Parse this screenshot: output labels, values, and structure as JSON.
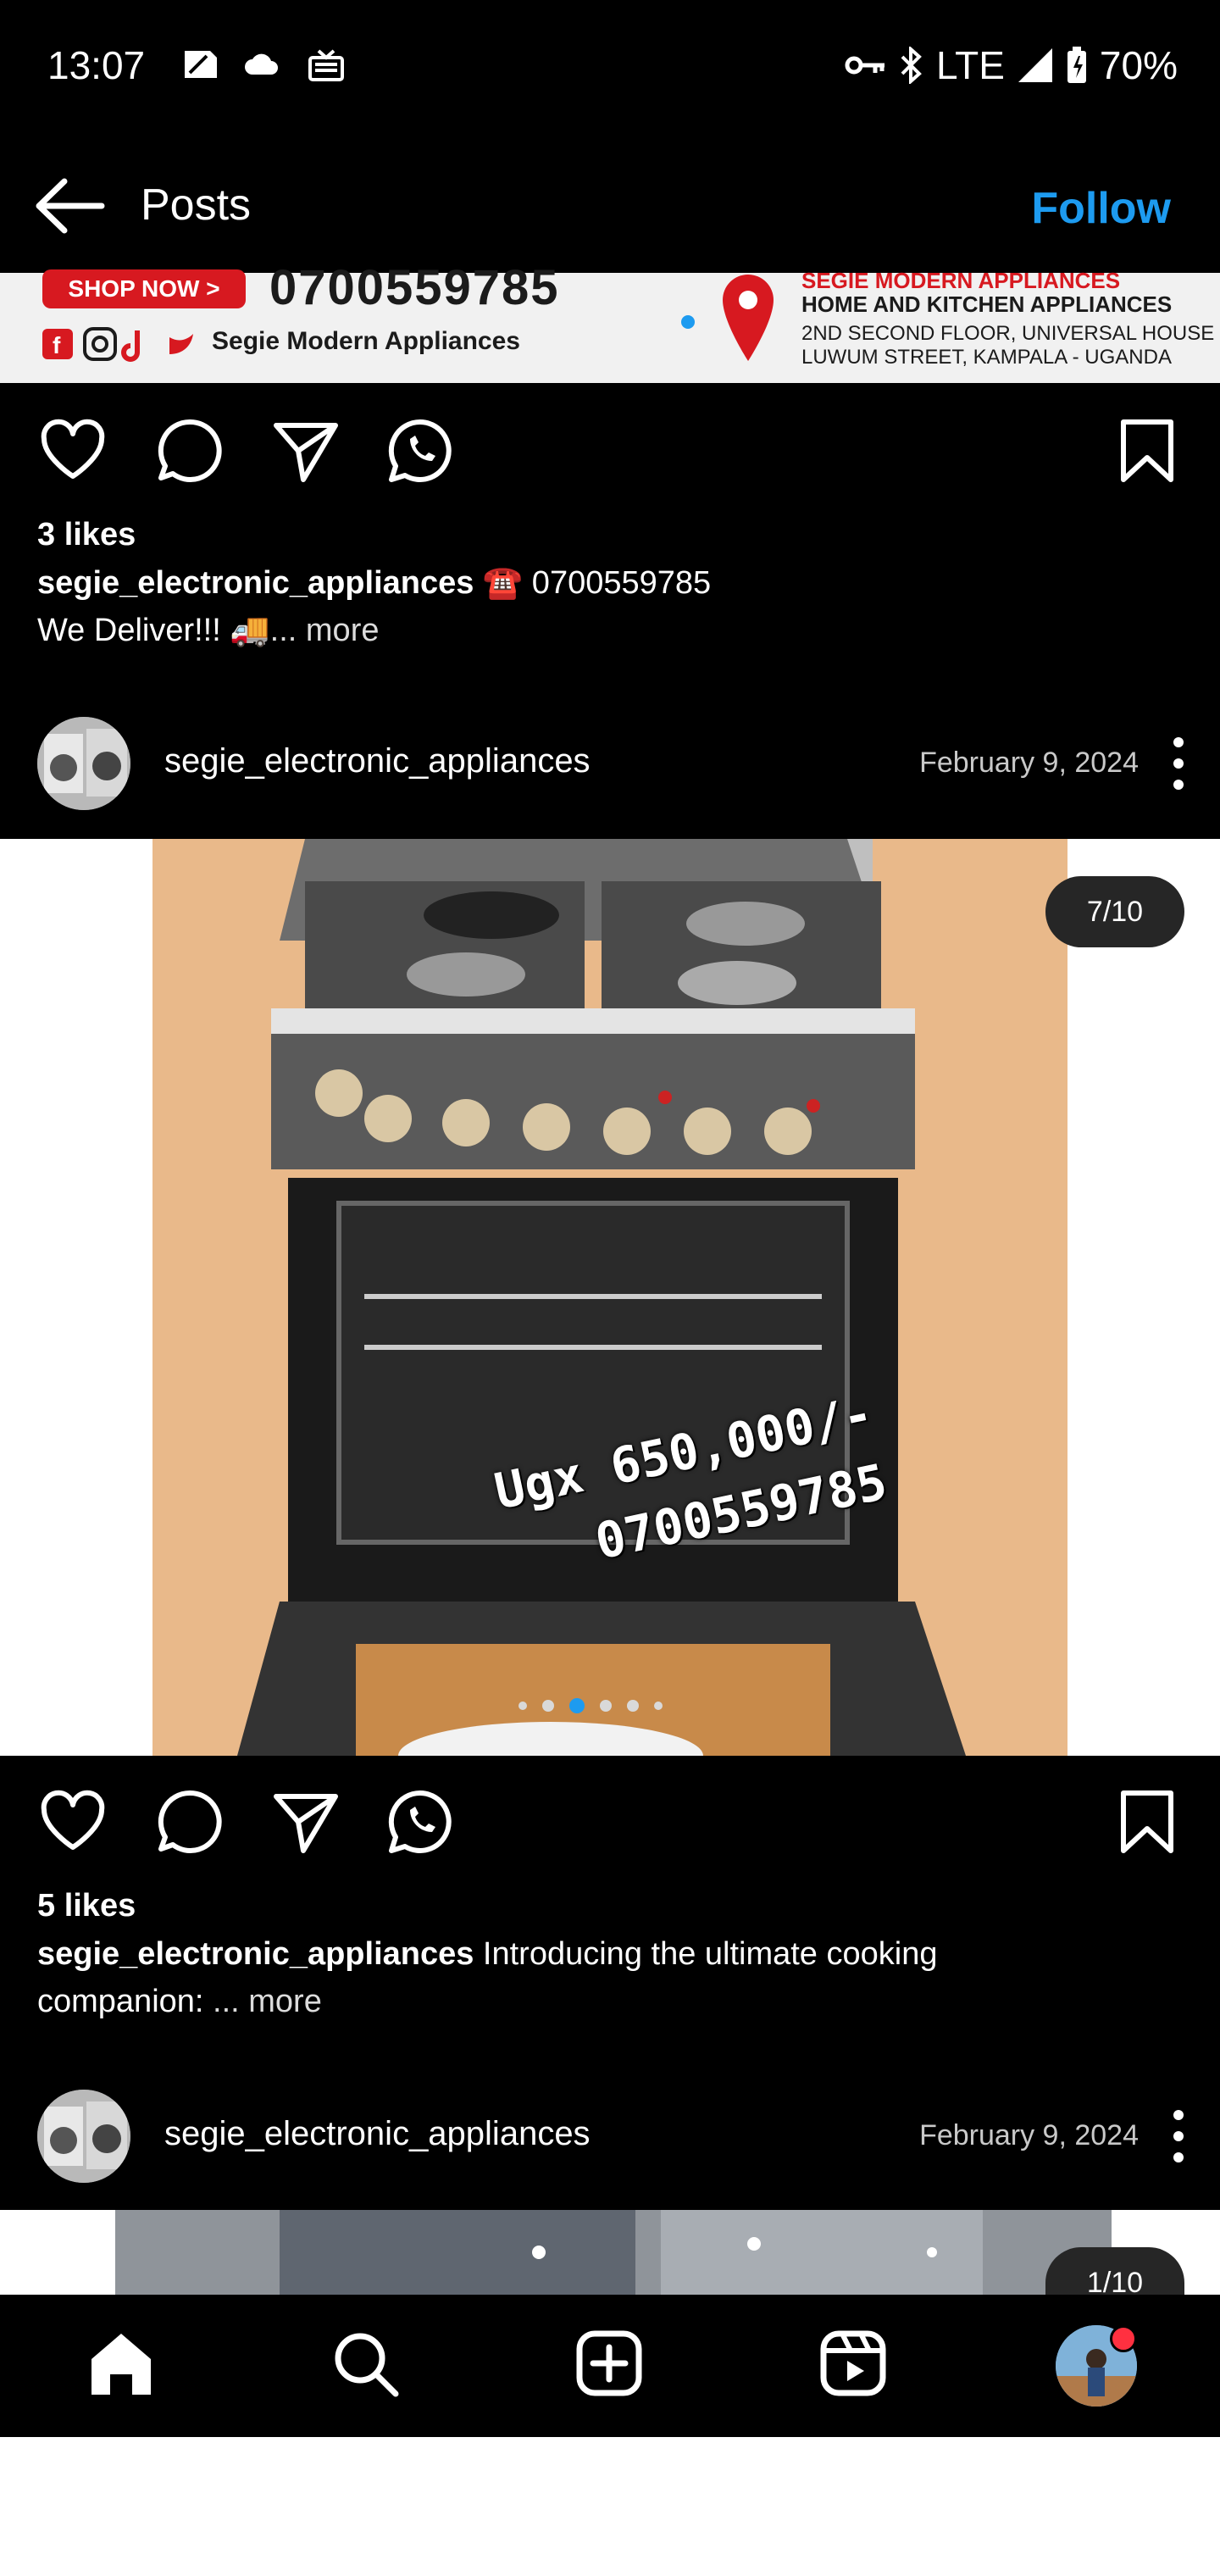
{
  "status_bar": {
    "time": "13:07",
    "network": "LTE",
    "battery": "70%",
    "icons": [
      "sim-icon",
      "cloud-icon",
      "cast-icon",
      "vpn-key-icon",
      "bluetooth-icon",
      "signal-icon",
      "battery-icon"
    ]
  },
  "header": {
    "title": "Posts",
    "follow_label": "Follow",
    "accent": "#1d9bf0"
  },
  "banner": {
    "shop_now": "SHOP NOW >",
    "phone": "0700559785",
    "brand": "Segie Modern Appliances",
    "company": "SEGIE MODERN APPLIANCES",
    "subtitle": "HOME AND KITCHEN APPLIANCES",
    "address1": "2ND SECOND FLOOR, UNIVERSAL HOUSE",
    "address2": "LUWUM STREET, KAMPALA - UGANDA"
  },
  "post1": {
    "likes": "3 likes",
    "username": "segie_electronic_appliances",
    "caption_text": " ☎️ 0700559785",
    "caption_line2": "We Deliver!!! 🚚",
    "more": "... more"
  },
  "post2": {
    "username": "segie_electronic_appliances",
    "date": "February 9, 2024",
    "counter": "7/10",
    "price_text": "Ugx 650,000/-",
    "phone_text": "0700559785",
    "likes": "5 likes",
    "caption_text": " Introducing the ultimate cooking",
    "caption_line2": "companion:",
    "more": " ... more",
    "carousel": {
      "total": 10,
      "current": 7
    }
  },
  "post3": {
    "username": "segie_electronic_appliances",
    "date": "February 9, 2024",
    "counter": "1/10"
  },
  "nav": {
    "items": [
      "home-icon",
      "search-icon",
      "create-icon",
      "reels-icon",
      "profile-avatar"
    ]
  }
}
